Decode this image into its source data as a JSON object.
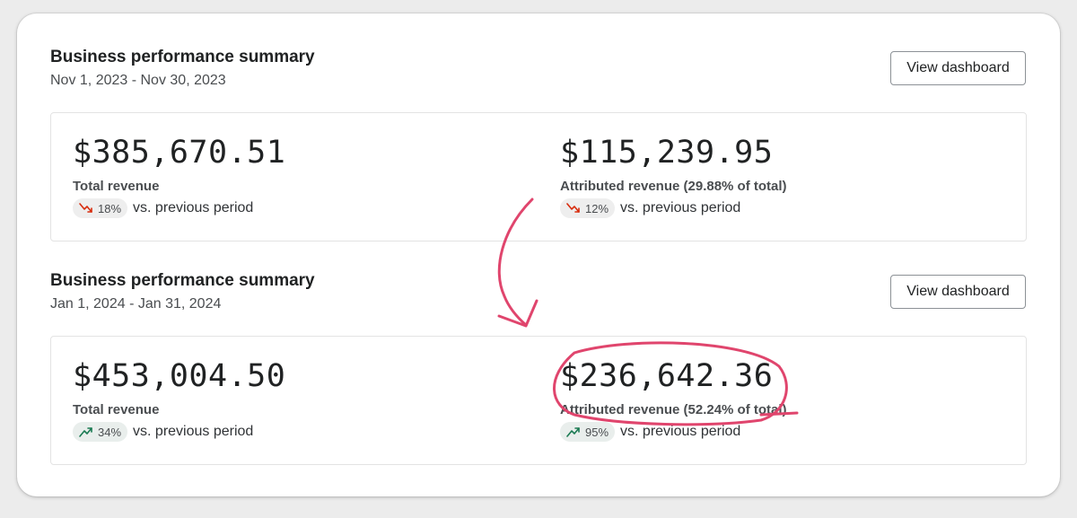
{
  "sections": [
    {
      "title": "Business performance summary",
      "date_range": "Nov 1, 2023 - Nov 30, 2023",
      "button_label": "View dashboard",
      "metrics": [
        {
          "value": "$385,670.51",
          "label": "Total revenue",
          "change": "18%",
          "direction": "down",
          "comparison": "vs. previous period"
        },
        {
          "value": "$115,239.95",
          "label": "Attributed revenue (29.88% of total)",
          "change": "12%",
          "direction": "down",
          "comparison": "vs. previous period"
        }
      ]
    },
    {
      "title": "Business performance summary",
      "date_range": "Jan 1, 2024 - Jan 31, 2024",
      "button_label": "View dashboard",
      "metrics": [
        {
          "value": "$453,004.50",
          "label": "Total revenue",
          "change": "34%",
          "direction": "up",
          "comparison": "vs. previous period"
        },
        {
          "value": "$236,642.36",
          "label": "Attributed revenue (52.24% of total)",
          "change": "95%",
          "direction": "up",
          "comparison": "vs. previous period"
        }
      ]
    }
  ],
  "colors": {
    "down": "#d82c0d",
    "up": "#1a7a52",
    "annotation": "#e0456d"
  },
  "icons": {
    "down": "trend-down-icon",
    "up": "trend-up-icon"
  }
}
